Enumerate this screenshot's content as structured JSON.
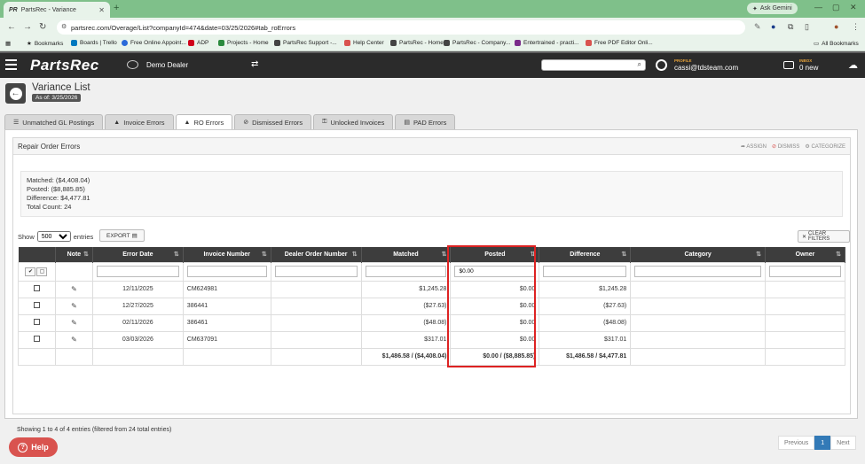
{
  "browser": {
    "tab_title": "PartsRec - Variance",
    "new_tab": "+",
    "ask_gemini": "Ask Gemini",
    "url": "partsrec.com/Overage/List?companyId=474&date=03/25/2026#tab_roErrors",
    "bookmarks": [
      {
        "label": "Bookmarks",
        "color": "#555"
      },
      {
        "label": "Boards | Trello",
        "color": "#0079bf"
      },
      {
        "label": "Free Online Appoint...",
        "color": "#2a6ad9"
      },
      {
        "label": "ADP",
        "color": "#d0021b"
      },
      {
        "label": "Projects - Home",
        "color": "#2b8a3e"
      },
      {
        "label": "PartsRec Support -...",
        "color": "#444"
      },
      {
        "label": "Help Center",
        "color": "#d9534f"
      },
      {
        "label": "PartsRec - Home",
        "color": "#444"
      },
      {
        "label": "PartsRec - Company...",
        "color": "#444"
      },
      {
        "label": "Entertrained - practi...",
        "color": "#7a2b8a"
      },
      {
        "label": "Free PDF Editor Onli...",
        "color": "#d9534f"
      }
    ],
    "all_bookmarks": "All Bookmarks"
  },
  "header": {
    "logo": "PartsRec",
    "dealer": "Demo Dealer",
    "profile_label": "PROFILE",
    "profile_email": "cassi@tdsteam.com",
    "inbox_label": "INBOX",
    "inbox_count": "0 new"
  },
  "page": {
    "title": "Variance List",
    "as_of": "As of: 3/25/2026",
    "tabs": [
      {
        "label": "Unmatched GL Postings",
        "icon": "list-icon",
        "glyph": "☰"
      },
      {
        "label": "Invoice Errors",
        "icon": "warning-icon",
        "glyph": "▲"
      },
      {
        "label": "RO Errors",
        "icon": "warning-icon",
        "glyph": "▲"
      },
      {
        "label": "Dismissed Errors",
        "icon": "check-circle-icon",
        "glyph": "⊘"
      },
      {
        "label": "Unlocked Invoices",
        "icon": "unlock-icon",
        "glyph": "🔓"
      },
      {
        "label": "PAD Errors",
        "icon": "document-icon",
        "glyph": "▤"
      }
    ],
    "active_tab": 2
  },
  "panel": {
    "title": "Repair Order Errors",
    "assign": "ASSIGN",
    "dismiss": "DISMISS",
    "categorize": "CATEGORIZE",
    "summary": {
      "matched": "Matched: ($4,408.04)",
      "posted": "Posted: ($8,885.85)",
      "difference": "Difference: $4,477.81",
      "total_count": "Total Count: 24"
    },
    "show_label": "Show",
    "entries_value": "500",
    "entries_label": "entries",
    "export": "EXPORT",
    "clear_filters": "CLEAR FILTERS"
  },
  "table": {
    "columns": [
      "",
      "Note",
      "Error Date",
      "Invoice Number",
      "Dealer Order Number",
      "Matched",
      "Posted",
      "Difference",
      "Category",
      "Owner"
    ],
    "posted_filter": "$0.00",
    "rows": [
      {
        "date": "12/11/2025",
        "invoice": "CM624981",
        "don": "",
        "matched": "$1,245.28",
        "posted": "$0.00",
        "difference": "$1,245.28",
        "category": "",
        "owner": ""
      },
      {
        "date": "12/27/2025",
        "invoice": "386441",
        "don": "",
        "matched": "($27.63)",
        "posted": "$0.00",
        "difference": "($27.63)",
        "category": "",
        "owner": ""
      },
      {
        "date": "02/11/2026",
        "invoice": "386461",
        "don": "",
        "matched": "($48.08)",
        "posted": "$0.00",
        "difference": "($48.08)",
        "category": "",
        "owner": ""
      },
      {
        "date": "03/03/2026",
        "invoice": "CM637091",
        "don": "",
        "matched": "$317.01",
        "posted": "$0.00",
        "difference": "$317.01",
        "category": "",
        "owner": ""
      }
    ],
    "totals": {
      "matched": "$1,486.58 / ($4,408.04)",
      "posted": "$0.00 / ($8,885.85)",
      "difference": "$1,486.58 / $4,477.81"
    },
    "showing": "Showing 1 to 4 of 4 entries (filtered from 24 total entries)",
    "pager": {
      "prev": "Previous",
      "page": "1",
      "next": "Next"
    }
  },
  "help": "Help"
}
